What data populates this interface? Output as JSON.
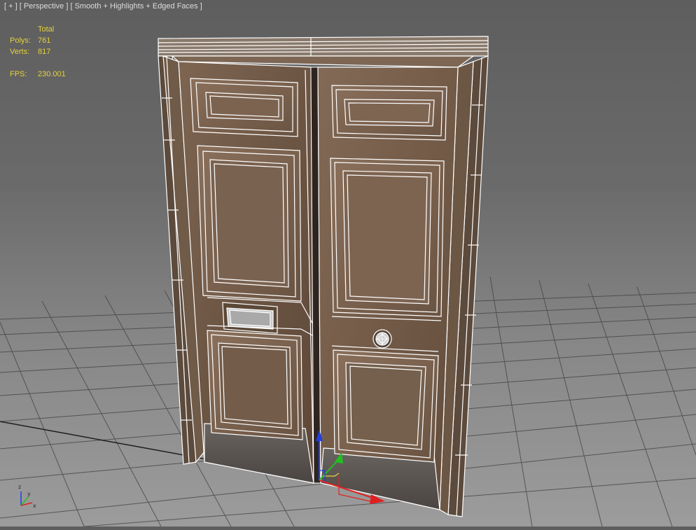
{
  "viewport": {
    "label": "[ + ] [ Perspective ] [ Smooth + Highlights + Edged Faces ]",
    "label_parts": [
      "+",
      "Perspective",
      "Smooth + Highlights + Edged Faces"
    ]
  },
  "stats": {
    "header": "Total",
    "polys_label": "Polys:",
    "polys_value": "761",
    "verts_label": "Verts:",
    "verts_value": "817",
    "fps_label": "FPS:",
    "fps_value": "230.001"
  },
  "axis_tripod": {
    "z": "z",
    "y": "y",
    "x": "x"
  },
  "colors": {
    "stats_text": "#e6d23a",
    "label_text": "#dcdcdc",
    "wood": "#6f5744",
    "wire": "#ffffff",
    "axis_x": "#e02020",
    "axis_y": "#20c020",
    "axis_z": "#2040e0"
  },
  "icons": {
    "gizmo": "transform-gizmo-icon",
    "tripod": "axis-tripod-icon",
    "knob": "door-knob-icon",
    "letterbox": "mail-slot-icon"
  }
}
